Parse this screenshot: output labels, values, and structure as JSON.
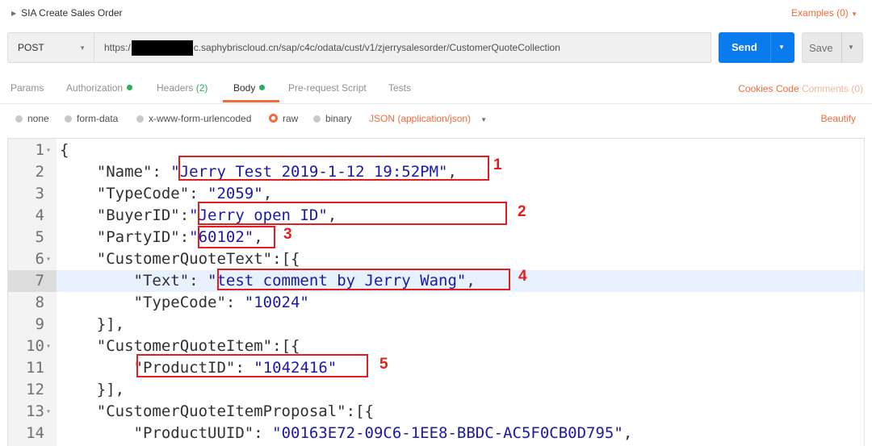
{
  "request": {
    "title": "SIA Create Sales Order",
    "examples_label": "Examples (0)",
    "method": "POST",
    "url_prefix": "https:/",
    "url_suffix": "c.saphybriscloud.cn/sap/c4c/odata/cust/v1/zjerrysalesorder/CustomerQuoteCollection",
    "send_label": "Send",
    "save_label": "Save"
  },
  "tabs": {
    "params": "Params",
    "authorization": "Authorization",
    "headers": "Headers",
    "headers_count": "(2)",
    "body": "Body",
    "prerequest": "Pre-request Script",
    "tests": "Tests",
    "cookies": "Cookies",
    "code": "Code",
    "comments": "Comments (0)"
  },
  "body_options": {
    "none": "none",
    "form_data": "form-data",
    "urlencoded": "x-www-form-urlencoded",
    "raw": "raw",
    "binary": "binary",
    "selected": "raw",
    "content_type": "JSON (application/json)",
    "beautify": "Beautify"
  },
  "editor": {
    "highlighted_line": 7,
    "lines": [
      {
        "n": "1",
        "fold": true,
        "indent": "",
        "key": "",
        "sep": "",
        "val": "",
        "tail": "{"
      },
      {
        "n": "2",
        "fold": false,
        "indent": "    ",
        "key": "\"Name\"",
        "sep": ": ",
        "val": "\"Jerry Test 2019-1-12 19:52PM\"",
        "tail": ","
      },
      {
        "n": "3",
        "fold": false,
        "indent": "    ",
        "key": "\"TypeCode\"",
        "sep": ": ",
        "val": "\"2059\"",
        "tail": ","
      },
      {
        "n": "4",
        "fold": false,
        "indent": "    ",
        "key": "\"BuyerID\"",
        "sep": ":",
        "val": "\"Jerry open ID\"",
        "tail": ","
      },
      {
        "n": "5",
        "fold": false,
        "indent": "    ",
        "key": "\"PartyID\"",
        "sep": ":",
        "val": "\"60102\"",
        "tail": ","
      },
      {
        "n": "6",
        "fold": true,
        "indent": "    ",
        "key": "\"CustomerQuoteText\"",
        "sep": ":",
        "val": "",
        "tail": "[{"
      },
      {
        "n": "7",
        "fold": false,
        "indent": "        ",
        "key": "\"Text\"",
        "sep": ": ",
        "val": "\"test comment by Jerry Wang\"",
        "tail": ","
      },
      {
        "n": "8",
        "fold": false,
        "indent": "        ",
        "key": "\"TypeCode\"",
        "sep": ": ",
        "val": "\"10024\"",
        "tail": ""
      },
      {
        "n": "9",
        "fold": false,
        "indent": "    ",
        "key": "",
        "sep": "",
        "val": "",
        "tail": "}],"
      },
      {
        "n": "10",
        "fold": true,
        "indent": "    ",
        "key": "\"CustomerQuoteItem\"",
        "sep": ":",
        "val": "",
        "tail": "[{"
      },
      {
        "n": "11",
        "fold": false,
        "indent": "        ",
        "key": "\"ProductID\"",
        "sep": ": ",
        "val": "\"1042416\"",
        "tail": ""
      },
      {
        "n": "12",
        "fold": false,
        "indent": "    ",
        "key": "",
        "sep": "",
        "val": "",
        "tail": "}],"
      },
      {
        "n": "13",
        "fold": true,
        "indent": "    ",
        "key": "\"CustomerQuoteItemProposal\"",
        "sep": ":",
        "val": "",
        "tail": "[{"
      },
      {
        "n": "14",
        "fold": false,
        "indent": "        ",
        "key": "\"ProductUUID\"",
        "sep": ": ",
        "val": "\"00163E72-09C6-1EE8-BBDC-AC5F0CB0D795\"",
        "tail": ","
      }
    ]
  },
  "annotations": [
    "1",
    "2",
    "3",
    "4",
    "5"
  ],
  "colors": {
    "accent": "#f26b3a",
    "send": "#097bed",
    "annotation": "#e02020"
  }
}
